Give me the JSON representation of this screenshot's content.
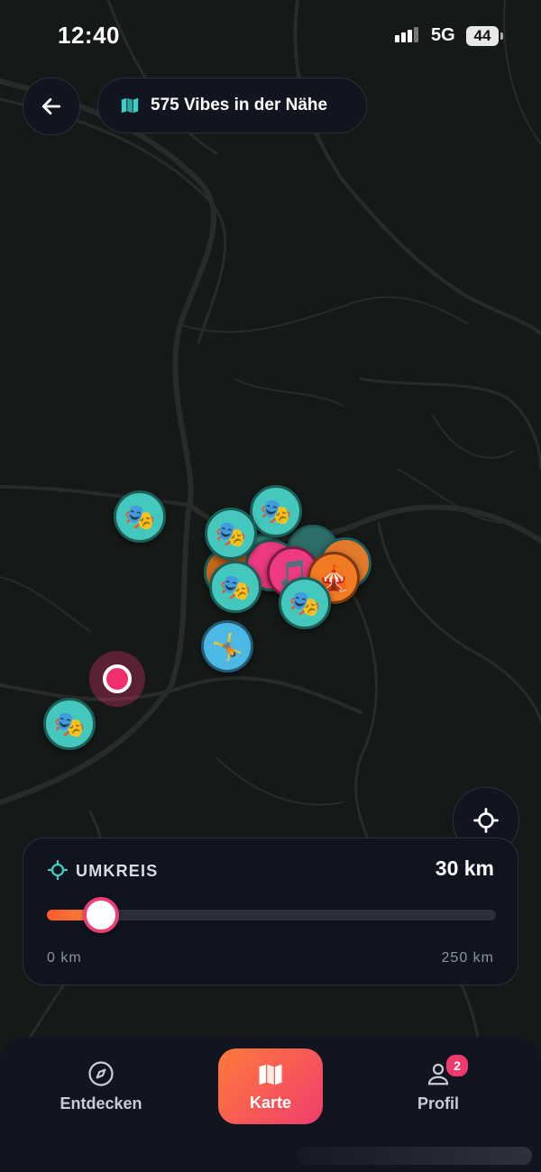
{
  "status_bar": {
    "time": "12:40",
    "network": "5G",
    "battery": "44"
  },
  "header": {
    "vibes_label": "575 Vibes in der Nähe",
    "map_icon": "map-icon",
    "back_icon": "arrow-left-icon"
  },
  "markers": [
    {
      "kind": "theater",
      "emoji": "🎭",
      "color": "teal"
    },
    {
      "kind": "theater",
      "emoji": "🎭",
      "color": "teal"
    },
    {
      "kind": "theater",
      "emoji": "🎭",
      "color": "teal"
    },
    {
      "kind": "music",
      "emoji": "🎵",
      "color": "pink"
    },
    {
      "kind": "circus",
      "emoji": "🎪",
      "color": "orange"
    },
    {
      "kind": "theater",
      "emoji": "🎭",
      "color": "teal"
    },
    {
      "kind": "theater",
      "emoji": "🎭",
      "color": "teal"
    },
    {
      "kind": "gymnastics",
      "emoji": "🤸",
      "color": "blue"
    },
    {
      "kind": "theater",
      "emoji": "🎭",
      "color": "teal"
    }
  ],
  "radius": {
    "title": "UMKREIS",
    "value_label": "30 km",
    "value_km": 30,
    "min_label": "0 km",
    "max_label": "250 km",
    "min_km": 0,
    "max_km": 250
  },
  "nav": {
    "items": [
      {
        "label": "Entdecken",
        "icon": "compass-icon"
      },
      {
        "label": "Karte",
        "icon": "map-icon"
      },
      {
        "label": "Profil",
        "icon": "user-icon"
      }
    ],
    "active": "Karte",
    "profile_badge": "2"
  },
  "colors": {
    "accent_orange": "#ff7a3a",
    "accent_pink": "#f03e6e",
    "marker_teal": "#44c8bd",
    "map_bg": "#151a18"
  }
}
